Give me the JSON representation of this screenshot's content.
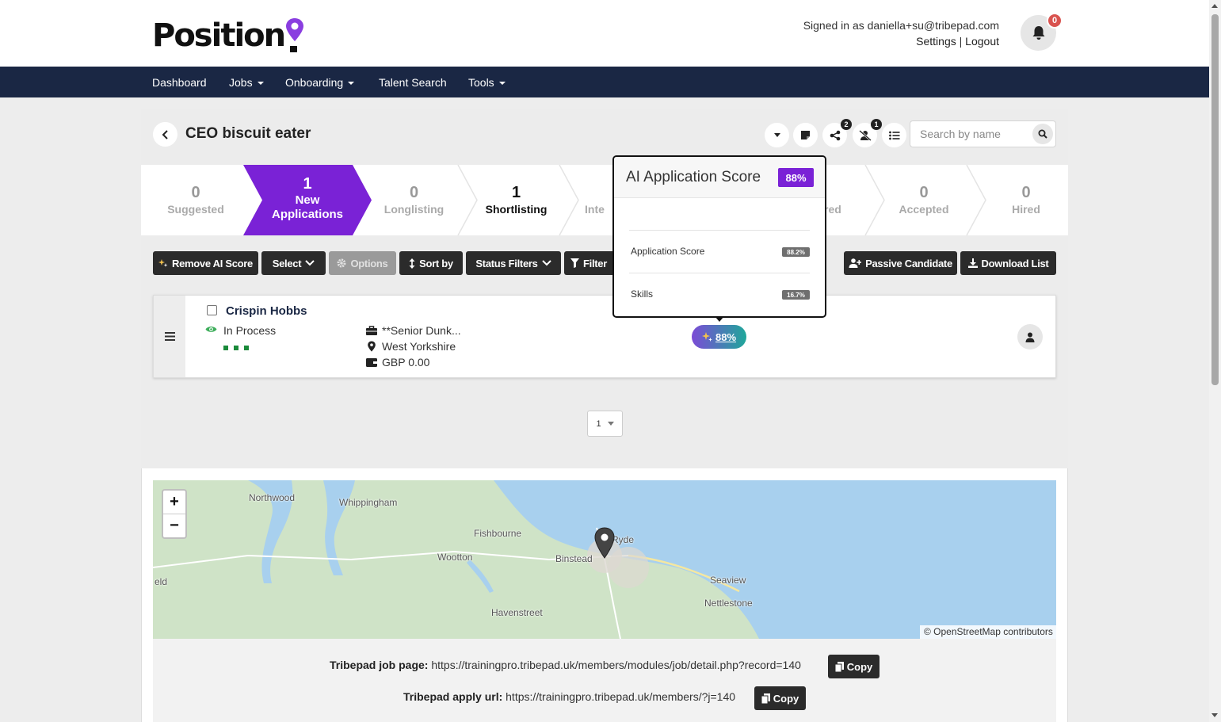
{
  "header": {
    "logo_text": "Position",
    "signed_in_text": "Signed in as daniella+su@tribepad.com",
    "settings_label": "Settings",
    "separator": "|",
    "logout_label": "Logout",
    "notification_count": "0"
  },
  "nav": {
    "items": [
      {
        "label": "Dashboard",
        "has_caret": false
      },
      {
        "label": "Jobs",
        "has_caret": true
      },
      {
        "label": "Onboarding",
        "has_caret": true
      },
      {
        "label": "Talent Search",
        "has_caret": false
      },
      {
        "label": "Tools",
        "has_caret": true
      }
    ]
  },
  "job": {
    "title": "CEO biscuit eater",
    "share_count": "2",
    "hidden_count": "1",
    "search_placeholder": "Search by name"
  },
  "stages": [
    {
      "count": "0",
      "label": "Suggested"
    },
    {
      "count": "1",
      "label": "New Applications",
      "label_line1": "New",
      "label_line2": "Applications",
      "active": true
    },
    {
      "count": "0",
      "label": "Longlisting"
    },
    {
      "count": "1",
      "label": "Shortlisting"
    },
    {
      "count": "",
      "label": "Inte"
    },
    {
      "count": "",
      "label": "red"
    },
    {
      "count": "0",
      "label": "Accepted"
    },
    {
      "count": "0",
      "label": "Hired"
    }
  ],
  "toolbar": {
    "remove_ai_score": "Remove AI Score",
    "select": "Select",
    "options": "Options",
    "sort_by": "Sort by",
    "status_filters": "Status Filters",
    "filter": "Filter",
    "passive_candidate": "Passive Candidate",
    "download_list": "Download List"
  },
  "candidate": {
    "name": "Crispin Hobbs",
    "status": "In Process",
    "job": "**Senior Dunk...",
    "location": "West Yorkshire",
    "salary": "GBP 0.00",
    "ai_score": "88%"
  },
  "ai_popover": {
    "title": "AI Application Score",
    "score": "88%",
    "rows": [
      {
        "label": "Application Score",
        "value": "88.2%"
      },
      {
        "label": "Skills",
        "value": "16.7%"
      }
    ]
  },
  "pagination": {
    "current_page": "1"
  },
  "map": {
    "labels": [
      "Northwood",
      "Whippingham",
      "Fishbourne",
      "Wootton",
      "Binstead",
      "Ryde",
      "eld",
      "Seaview",
      "Nettlestone",
      "Havenstreet"
    ],
    "zoom_in": "+",
    "zoom_out": "−",
    "attribution": "© OpenStreetMap contributors"
  },
  "links": {
    "job_page_label": "Tribepad job page:",
    "job_page_url": "https://trainingpro.tribepad.uk/members/modules/job/detail.php?record=140",
    "apply_url_label": "Tribepad apply url:",
    "apply_url": "https://trainingpro.tribepad.uk/members/?j=140",
    "copy_label": "Copy"
  },
  "colors": {
    "nav_bg": "#1a2744",
    "active_stage": "#7a22d6",
    "brand_purple": "#8a3ee0",
    "dark_button": "#2b2b2b",
    "status_green": "#1a8a3a",
    "badge_red": "#d9534f"
  }
}
